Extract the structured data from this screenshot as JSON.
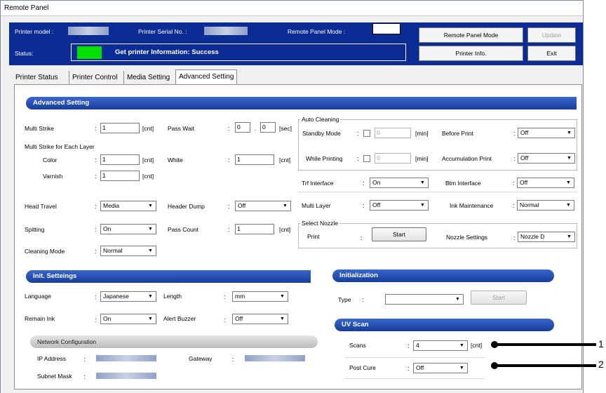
{
  "window": {
    "title": "Remote Panel"
  },
  "header": {
    "printer_model_label": "Printer model :",
    "serial_label": "Printer Serial No. :",
    "mode_label": "Remote Panel Mode :",
    "status_label": "Status:",
    "status_text": "Get printer Information: Success",
    "status_color": "#00e000",
    "buttons": {
      "remote_panel_mode": "Remote Panel Mode",
      "update": "Update",
      "printer_info": "Printer Info.",
      "exit": "Exit"
    }
  },
  "tabs": [
    "Printer Status",
    "Printer Control",
    "Media Setting",
    "Advanced Setting"
  ],
  "advanced": {
    "title": "Advanced Setting",
    "multi_strike": {
      "label": "Multi Strike",
      "value": "1",
      "unit": "[cnt]"
    },
    "pass_wait": {
      "label": "Pass Wait",
      "value1": "0",
      "sep": ".",
      "value2": "0",
      "unit": "[sec]"
    },
    "multi_strike_layer": "Multi Strike for Each Layer",
    "color": {
      "label": "Color",
      "value": "1",
      "unit": "[cnt]"
    },
    "white": {
      "label": "White",
      "value": "1",
      "unit": "[cnt]"
    },
    "varnish": {
      "label": "Varnish",
      "value": "1",
      "unit": "[cnt]"
    },
    "head_travel": {
      "label": "Head Travel",
      "value": "Media"
    },
    "header_dump": {
      "label": "Header Dump",
      "value": "Off"
    },
    "spitting": {
      "label": "Spitting",
      "value": "On"
    },
    "pass_count": {
      "label": "Pass Count",
      "value": "1",
      "unit": "[cnt]"
    },
    "cleaning_mode": {
      "label": "Cleaning Mode",
      "value": "Normal"
    },
    "auto_cleaning": {
      "title": "Auto Cleaning",
      "standby": {
        "label": "Standby Mode",
        "value": "0",
        "unit": "[min]"
      },
      "while_printing": {
        "label": "While Printing",
        "value": "0",
        "unit": "[min]"
      },
      "before_print": {
        "label": "Before Print",
        "value": "Off"
      },
      "accumulation": {
        "label": "Accumulation Print",
        "value": "Off"
      }
    },
    "trf_interface": {
      "label": "Trf Interface",
      "value": "On"
    },
    "btm_interface": {
      "label": "Btm Interface",
      "value": "Off"
    },
    "multi_layer": {
      "label": "Multi Layer",
      "value": "Off"
    },
    "ink_maintenance": {
      "label": "Ink Maintenance",
      "value": "Normal"
    },
    "select_nozzle": {
      "title": "Select Nozzle",
      "print_label": "Print",
      "start": "Start",
      "nozzle_settings_label": "Nozzle Settings",
      "nozzle_value": "Nozzle D"
    }
  },
  "init": {
    "title": "Init. Setteings",
    "language": {
      "label": "Language",
      "value": "Japanese"
    },
    "length": {
      "label": "Length",
      "value": "mm"
    },
    "remain_ink": {
      "label": "Remain Ink",
      "value": "On"
    },
    "alert_buzzer": {
      "label": "Alert Buzzer",
      "value": "Off"
    }
  },
  "network": {
    "title": "Network Configuration",
    "ip_label": "IP Address",
    "gateway_label": "Gateway",
    "subnet_label": "Subnet Mask"
  },
  "initialization": {
    "title": "Initialization",
    "type_label": "Type",
    "type_value": "",
    "start": "Start"
  },
  "uv_scan": {
    "title": "UV Scan",
    "scans": {
      "label": "Scans",
      "value": "4",
      "unit": "[cnt]"
    },
    "post_cure": {
      "label": "Post Cure",
      "value": "Off"
    }
  },
  "callouts": [
    "1",
    "2"
  ],
  "colon": ":"
}
